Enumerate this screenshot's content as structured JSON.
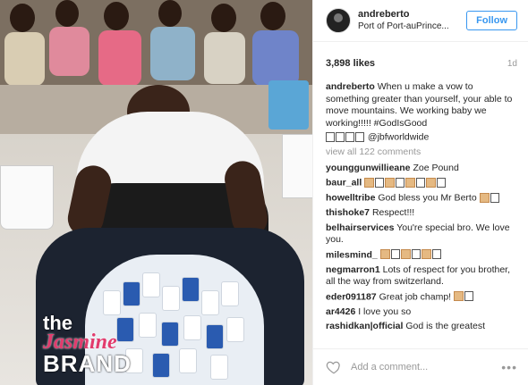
{
  "post": {
    "username": "andreberto",
    "location": "Port of Port-auPrince...",
    "follow_label": "Follow",
    "likes": "3,898 likes",
    "age": "1d",
    "caption_user": "andreberto",
    "caption_text": "When u make a vow to something greater than yourself, your able to move mountains. We working baby we working!!!!! #GodIsGood",
    "caption_tag": "@jbfworldwide",
    "view_all": "view all 122 comments",
    "add_comment_placeholder": "Add a comment...",
    "more_label": "•••"
  },
  "comments": [
    {
      "user": "younggunwillieane",
      "text": "Zoe Pound"
    },
    {
      "user": "baur_all",
      "text": ""
    },
    {
      "user": "howelltribe",
      "text": "God bless you Mr Berto"
    },
    {
      "user": "thishoke7",
      "text": "Respect!!!"
    },
    {
      "user": "belhairservices",
      "text": "You're special bro. We love you."
    },
    {
      "user": "milesmind_",
      "text": ""
    },
    {
      "user": "negmarron1",
      "text": "Lots of respect for you brother, all the way from switzerland."
    },
    {
      "user": "eder091187",
      "text": "Great job champ!"
    },
    {
      "user": "ar4426",
      "text": "I love you so"
    },
    {
      "user": "rashidkan|official",
      "text": "God is the greatest"
    }
  ],
  "watermark": {
    "the": "the",
    "jasmine": "Jasmine",
    "brand": "BRAND"
  },
  "colors": {
    "accent": "#3897f0",
    "muted": "#999999",
    "watermark_pink": "#e23b6d"
  },
  "icons": {
    "heart": "heart-outline-icon",
    "more": "more-options-icon"
  }
}
